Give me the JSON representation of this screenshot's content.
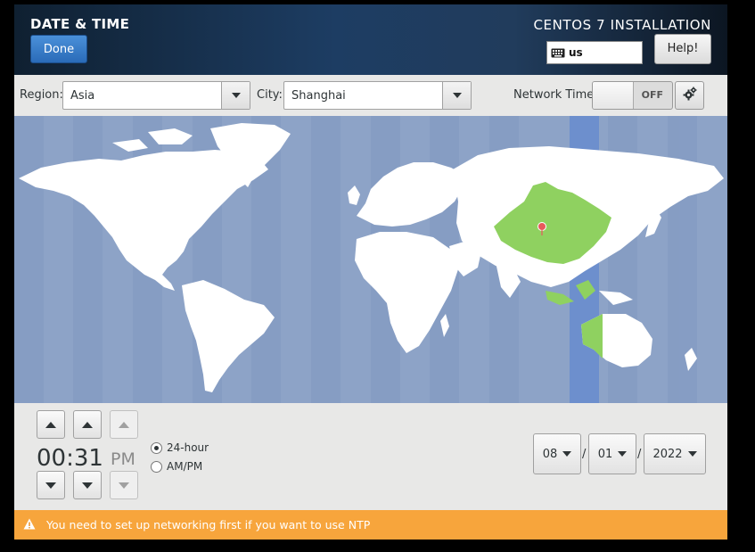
{
  "header": {
    "spoke_title": "DATE & TIME",
    "done_label": "Done",
    "install_title": "CENTOS 7 INSTALLATION",
    "keyboard_layout": "us",
    "help_label": "Help!"
  },
  "toolbar": {
    "region_label": "Region:",
    "region_value": "Asia",
    "city_label": "City:",
    "city_value": "Shanghai",
    "network_time_label": "Network Time",
    "network_time_state": "OFF"
  },
  "map": {
    "selected_city": "Shanghai",
    "land_color": "#ffffff",
    "ocean_color": "#8da3c7",
    "timezone_highlight_color": "#6d8fcd",
    "selected_zone_color": "#8fd160",
    "pin_color": "#e8595b"
  },
  "time": {
    "hours": "00",
    "minutes": "31",
    "separator": ":",
    "ampm": "PM",
    "format_24h_label": "24-hour",
    "format_ampm_label": "AM/PM",
    "selected_format": "24-hour"
  },
  "date": {
    "month": "08",
    "day": "01",
    "year": "2022",
    "separator": "/"
  },
  "warning": {
    "message": "You need to set up networking first if you want to use NTP",
    "color": "#f7a53c"
  }
}
